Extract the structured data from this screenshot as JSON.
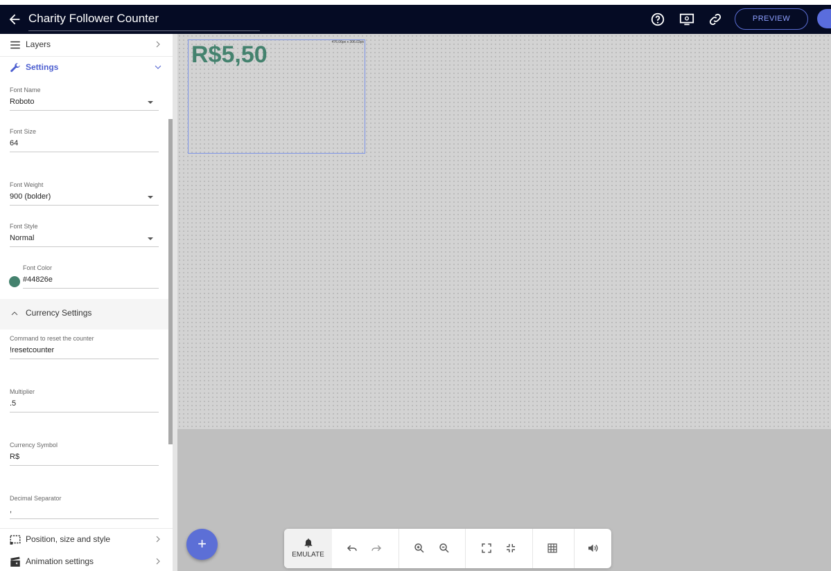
{
  "header": {
    "title": "Charity Follower Counter",
    "preview_label": "PREVIEW"
  },
  "sidebar": {
    "layers_label": "Layers",
    "settings_label": "Settings",
    "fields": {
      "font_name": {
        "label": "Font Name",
        "value": "Roboto"
      },
      "font_size": {
        "label": "Font Size",
        "value": "64"
      },
      "font_weight": {
        "label": "Font Weight",
        "value": "900 (bolder)"
      },
      "font_style": {
        "label": "Font Style",
        "value": "Normal"
      },
      "font_color": {
        "label": "Font Color",
        "value": "#44826e"
      }
    },
    "currency_settings_label": "Currency Settings",
    "currency": {
      "reset_command": {
        "label": "Command to reset the counter",
        "value": "!resetcounter"
      },
      "multiplier": {
        "label": "Multiplier",
        "value": ".5"
      },
      "currency_symbol": {
        "label": "Currency Symbol",
        "value": "R$"
      },
      "decimal_separator": {
        "label": "Decimal Separator",
        "value": ","
      }
    },
    "position_label": "Position, size and style",
    "animation_label": "Animation settings"
  },
  "canvas": {
    "widget_text": "R$5,50",
    "widget_dims": "476.06px x 306.03px"
  },
  "toolbar": {
    "emulate_label": "EMULATE",
    "fab_label": "+"
  },
  "colors": {
    "accent": "#5c6fd6",
    "header_bg": "#050b24",
    "font_color": "#44826e"
  }
}
